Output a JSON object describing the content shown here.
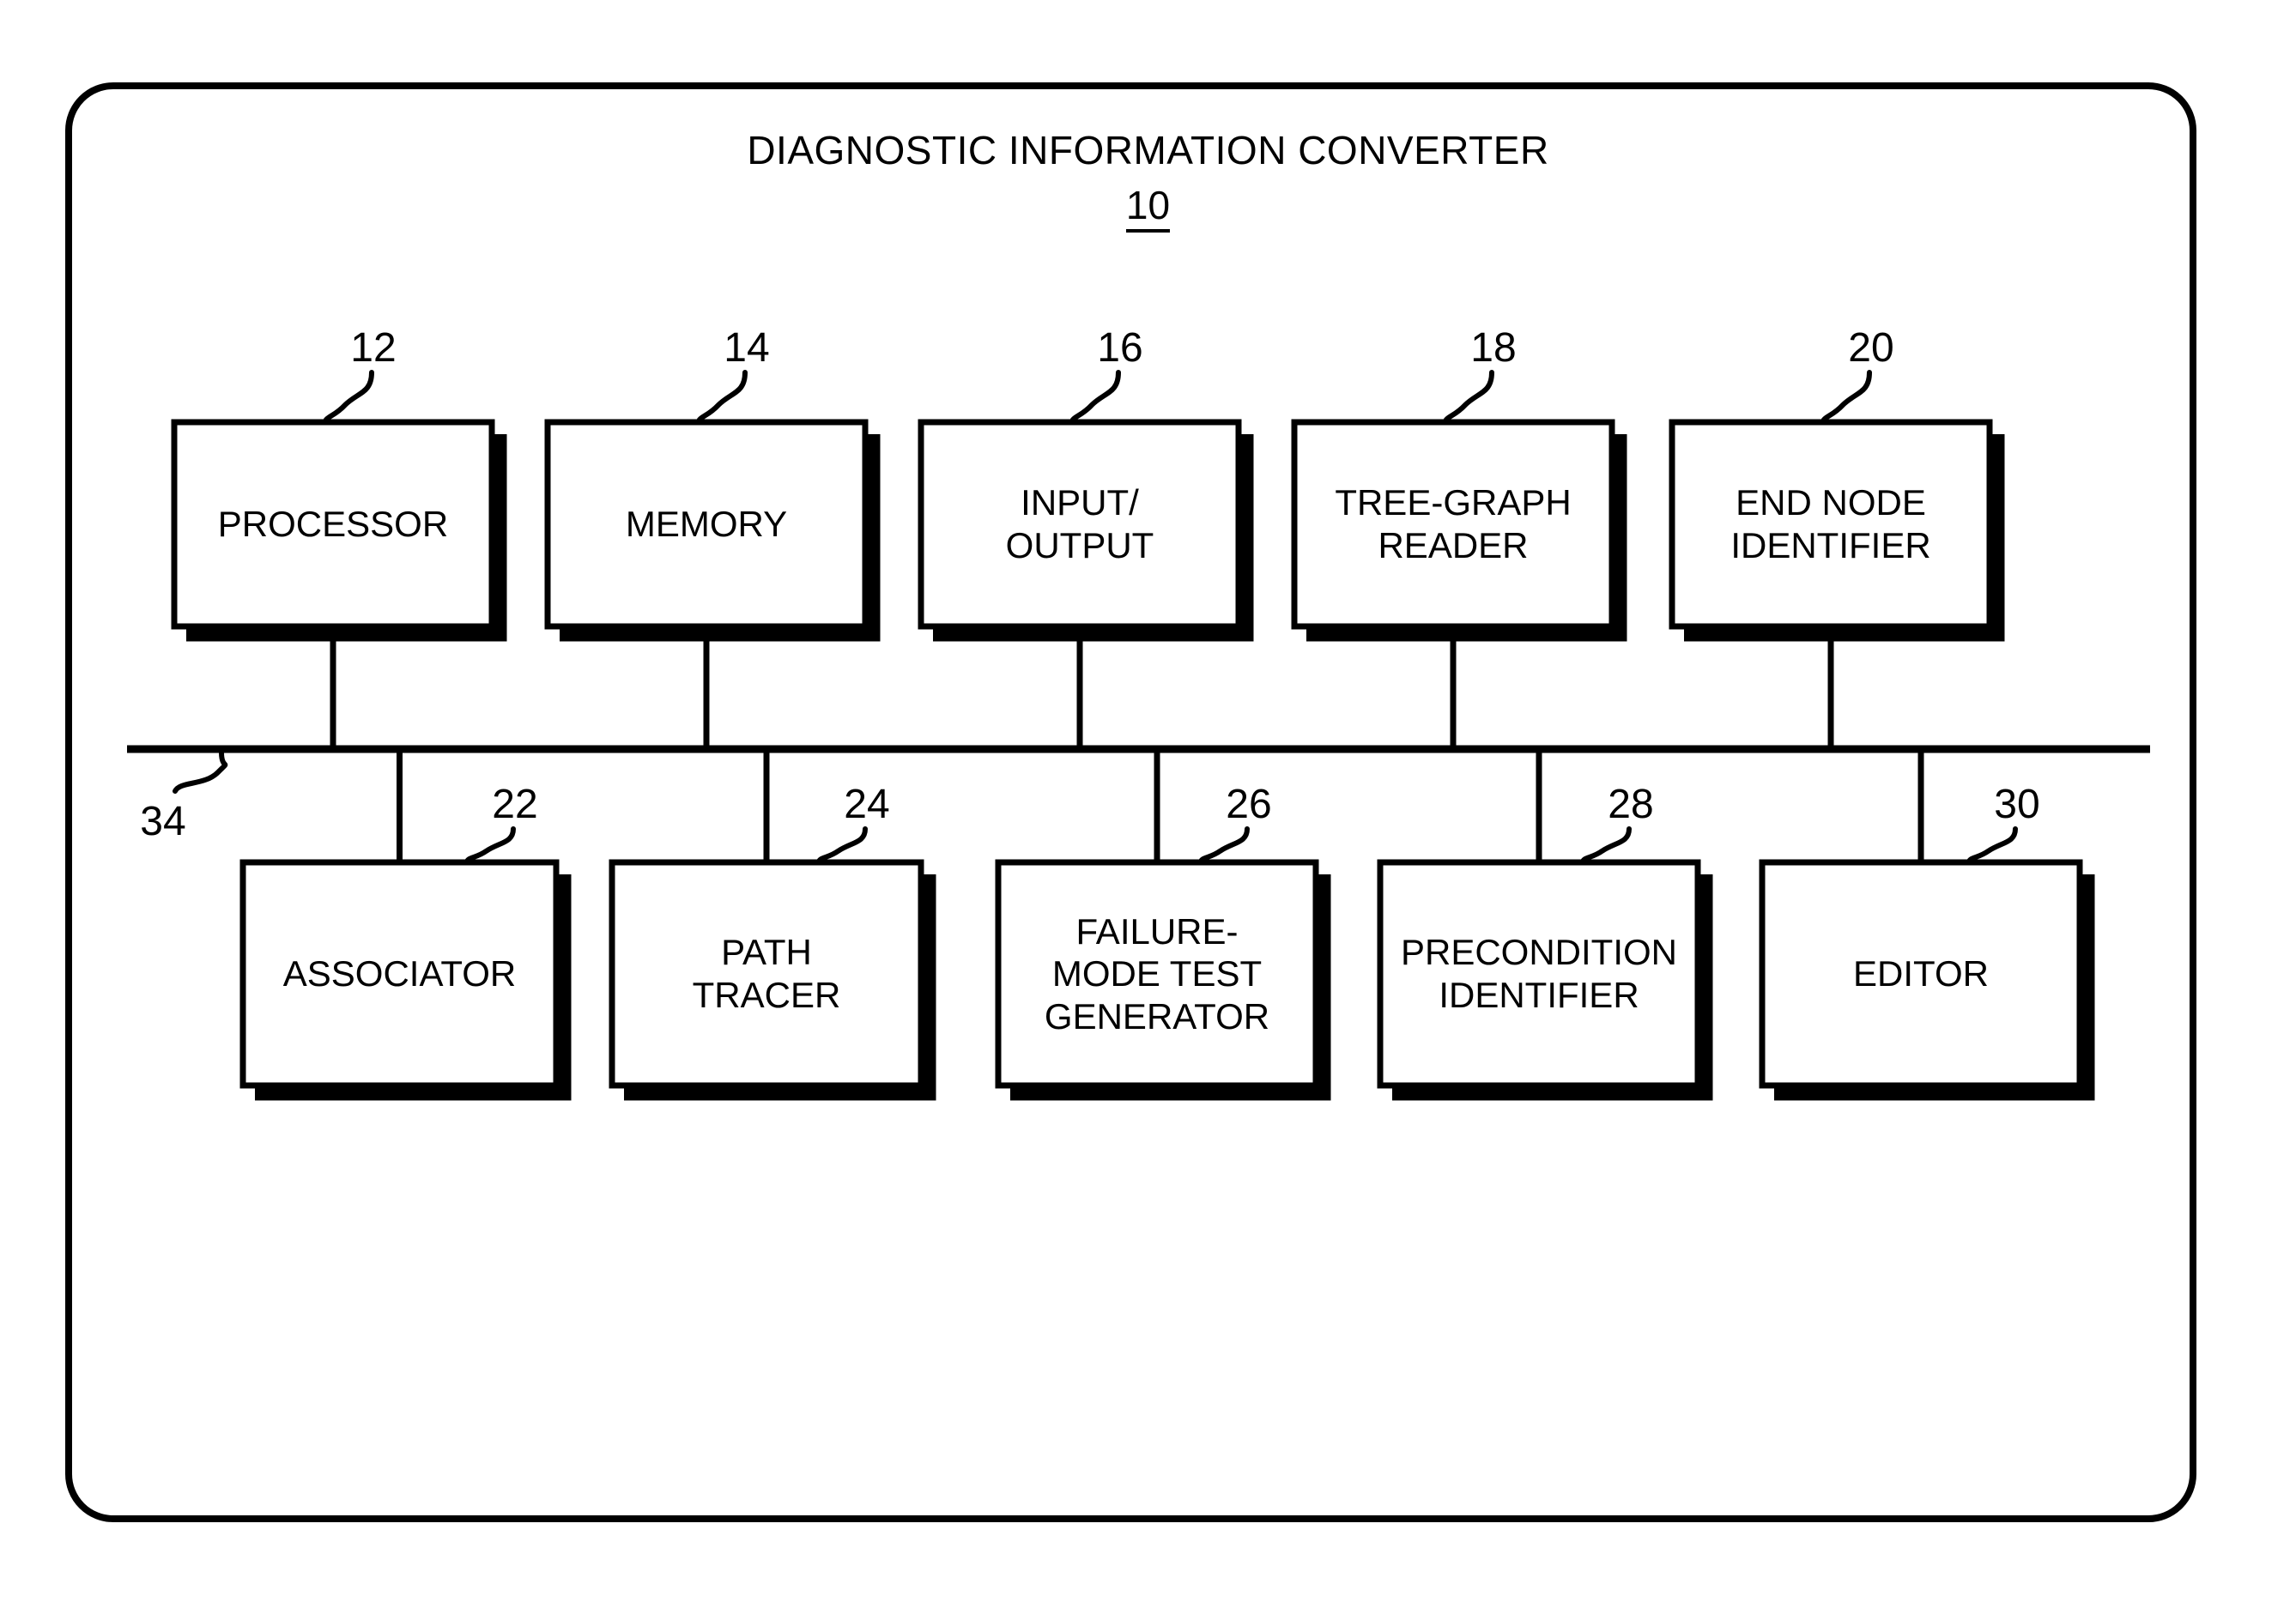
{
  "figure": {
    "title": "DIAGNOSTIC INFORMATION CONVERTER",
    "figure_reference_numeral": "10",
    "bus": {
      "label": "34",
      "name": "system-bus"
    },
    "colors": {
      "stroke": "#000000",
      "background": "#ffffff"
    }
  },
  "top_row": [
    {
      "ref": "12",
      "label": "PROCESSOR",
      "lines": [
        "PROCESSOR"
      ]
    },
    {
      "ref": "14",
      "label": "MEMORY",
      "lines": [
        "MEMORY"
      ]
    },
    {
      "ref": "16",
      "label": "INPUT/ OUTPUT",
      "lines": [
        "INPUT/",
        "OUTPUT"
      ]
    },
    {
      "ref": "18",
      "label": "TREE-GRAPH READER",
      "lines": [
        "TREE-GRAPH",
        "READER"
      ]
    },
    {
      "ref": "20",
      "label": "END NODE IDENTIFIER",
      "lines": [
        "END NODE",
        "IDENTIFIER"
      ]
    }
  ],
  "bottom_row": [
    {
      "ref": "22",
      "label": "ASSOCIATOR",
      "lines": [
        "ASSOCIATOR"
      ]
    },
    {
      "ref": "24",
      "label": "PATH TRACER",
      "lines": [
        "PATH",
        "TRACER"
      ]
    },
    {
      "ref": "26",
      "label": "FAILURE-MODE TEST GENERATOR",
      "lines": [
        "FAILURE-",
        "MODE TEST",
        "GENERATOR"
      ]
    },
    {
      "ref": "28",
      "label": "PRECONDITION IDENTIFIER",
      "lines": [
        "PRECONDITION",
        "IDENTIFIER"
      ]
    },
    {
      "ref": "30",
      "label": "EDITOR",
      "lines": [
        "EDITOR"
      ]
    }
  ]
}
